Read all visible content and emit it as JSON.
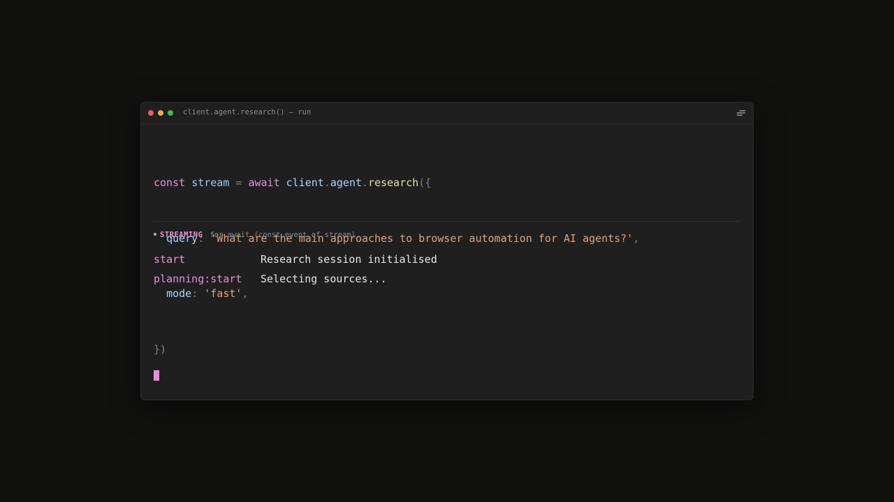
{
  "window": {
    "title": "client.agent.research() — run"
  },
  "code": {
    "line1": {
      "kw_const": "const",
      "var_stream": "stream",
      "eq": "=",
      "kw_await": "await",
      "obj_client": "client",
      "dot1": ".",
      "obj_agent": "agent",
      "dot2": ".",
      "fn_research": "research",
      "open": "({"
    },
    "line2": {
      "prop": "query",
      "colon": ":",
      "value": "'What are the main approaches to browser automation for AI agents?'",
      "comma": ","
    },
    "line3": {
      "prop": "mode",
      "colon": ":",
      "value": "'fast'",
      "comma": ","
    },
    "line4": {
      "close": "})"
    }
  },
  "status": {
    "label": "STREAMING",
    "sub": "for await (const event of stream)"
  },
  "events": [
    {
      "name": "start",
      "message": "Research session initialised"
    },
    {
      "name": "planning:start",
      "message": "Selecting sources..."
    }
  ],
  "colors": {
    "accent": "#e592d8",
    "background": "#111110",
    "panel": "#1f1f20"
  },
  "icons": {
    "menu": "menu-lines-icon"
  }
}
